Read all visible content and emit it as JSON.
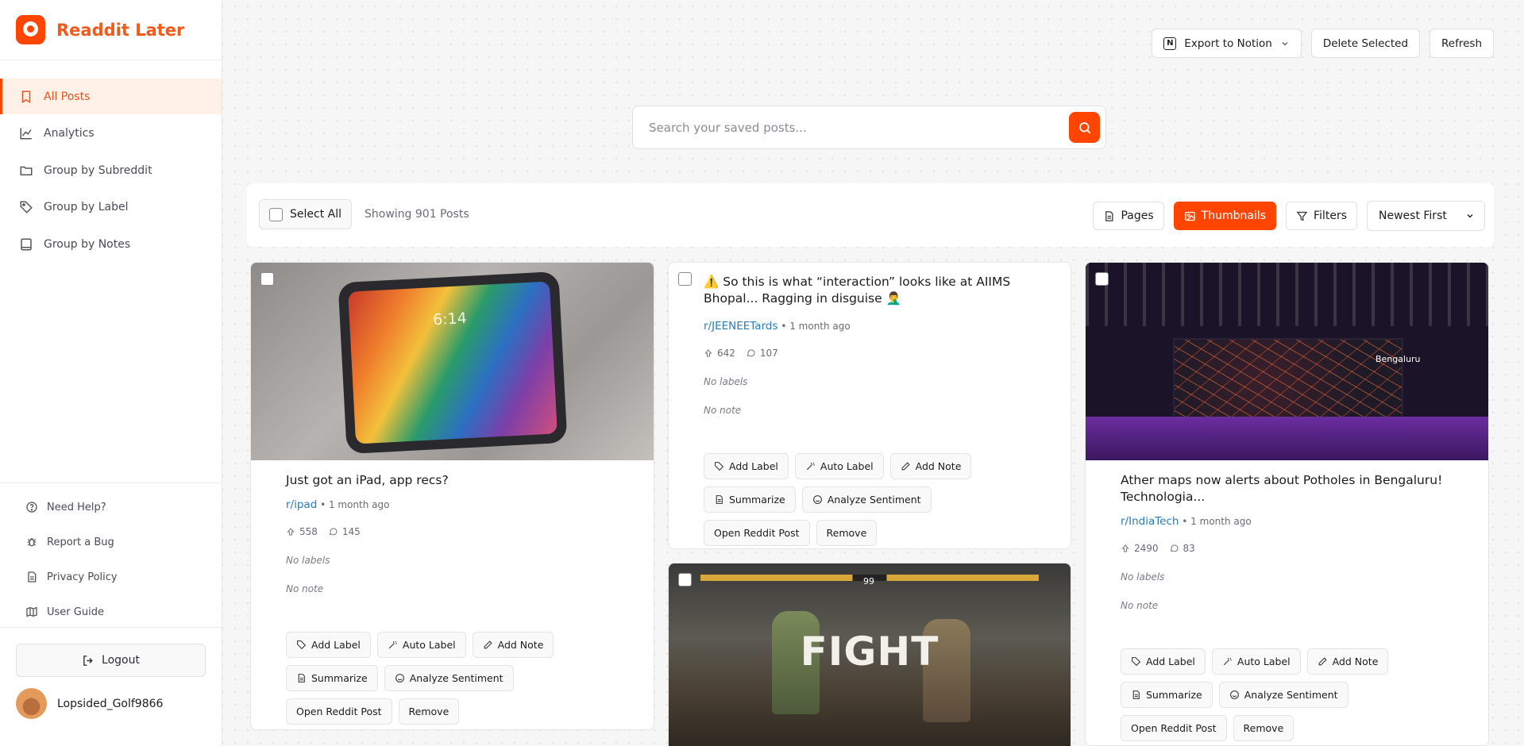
{
  "app": {
    "name": "Readdit Later"
  },
  "sidebar": {
    "nav": [
      {
        "label": "All Posts",
        "active": true
      },
      {
        "label": "Analytics"
      },
      {
        "label": "Group by Subreddit"
      },
      {
        "label": "Group by Label"
      },
      {
        "label": "Group by Notes"
      }
    ],
    "footer": [
      {
        "label": "Need Help?"
      },
      {
        "label": "Report a Bug"
      },
      {
        "label": "Privacy Policy"
      },
      {
        "label": "User Guide"
      }
    ],
    "logout_label": "Logout",
    "username": "Lopsided_Golf9866"
  },
  "header": {
    "export_label": "Export to Notion",
    "delete_label": "Delete Selected",
    "refresh_label": "Refresh"
  },
  "search": {
    "placeholder": "Search your saved posts..."
  },
  "toolbar": {
    "select_all_label": "Select All",
    "showing_text": "Showing 901 Posts",
    "pages_label": "Pages",
    "thumbnails_label": "Thumbnails",
    "filters_label": "Filters",
    "sort_value": "Newest First"
  },
  "action_labels": {
    "add_label": "Add Label",
    "auto_label": "Auto Label",
    "add_note": "Add Note",
    "summarize": "Summarize",
    "analyze": "Analyze Sentiment",
    "open": "Open Reddit Post",
    "remove": "Remove"
  },
  "posts": [
    {
      "title": "Just got an iPad, app recs?",
      "subreddit": "r/ipad",
      "time": " • 1 month ago",
      "upvotes": "558",
      "comments": "145",
      "labels": "No labels",
      "note": "No note",
      "thumb_text": "6:14"
    },
    {
      "title": "⚠️ So this is what “interaction” looks like at AIIMS Bhopal... Ragging in disguise 🤦‍♂️",
      "subreddit": "r/JEENEETards",
      "time": " • 1 month ago",
      "upvotes": "642",
      "comments": "107",
      "labels": "No labels",
      "note": "No note"
    },
    {
      "title": "Ather maps now alerts about Potholes in Bengaluru! Technologia...",
      "subreddit": "r/IndiaTech",
      "time": " • 1 month ago",
      "upvotes": "2490",
      "comments": "83",
      "labels": "No labels",
      "note": "No note",
      "thumb_text": "Bengaluru"
    },
    {
      "thumb_text": "FIGHT",
      "hud_text": "99"
    }
  ],
  "colors": {
    "accent": "#ff4500",
    "link": "#2a7ab8"
  }
}
